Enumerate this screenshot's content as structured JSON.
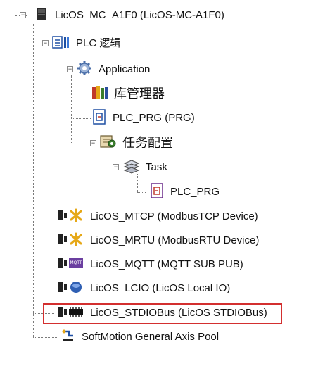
{
  "tree": {
    "device": {
      "label": "LicOS_MC_A1F0 (LicOS-MC-A1F0)",
      "icon": "device-icon"
    },
    "plc_logic": {
      "label": "PLC 逻辑",
      "icon": "plc-logic-icon"
    },
    "application": {
      "label": "Application",
      "icon": "gear-icon"
    },
    "library_manager": {
      "label": "库管理器",
      "icon": "library-icon"
    },
    "plc_prg": {
      "label": "PLC_PRG (PRG)",
      "icon": "program-icon"
    },
    "task_config": {
      "label": "任务配置",
      "icon": "task-config-icon"
    },
    "task": {
      "label": "Task",
      "icon": "task-icon"
    },
    "task_plc_prg": {
      "label": "PLC_PRG",
      "icon": "program-call-icon"
    },
    "mtcp": {
      "label": "LicOS_MTCP (ModbusTCP Device)",
      "icon": "modbus-tcp-icon"
    },
    "mrtu": {
      "label": "LicOS_MRTU (ModbusRTU Device)",
      "icon": "modbus-rtu-icon"
    },
    "mqtt": {
      "label": "LicOS_MQTT (MQTT SUB PUB)",
      "icon": "mqtt-icon",
      "icon_text": "MQTT"
    },
    "lcio": {
      "label": "LicOS_LCIO (LicOS Local IO)",
      "icon": "local-io-icon"
    },
    "stdiobus": {
      "label": "LicOS_STDIOBus (LicOS STDIOBus)",
      "icon": "io-bus-icon",
      "highlighted": true
    },
    "softmotion": {
      "label": "SoftMotion General Axis Pool",
      "icon": "axis-pool-icon"
    }
  },
  "colors": {
    "highlight": "#d32f2f",
    "tree_line": "#7a7a7a"
  }
}
